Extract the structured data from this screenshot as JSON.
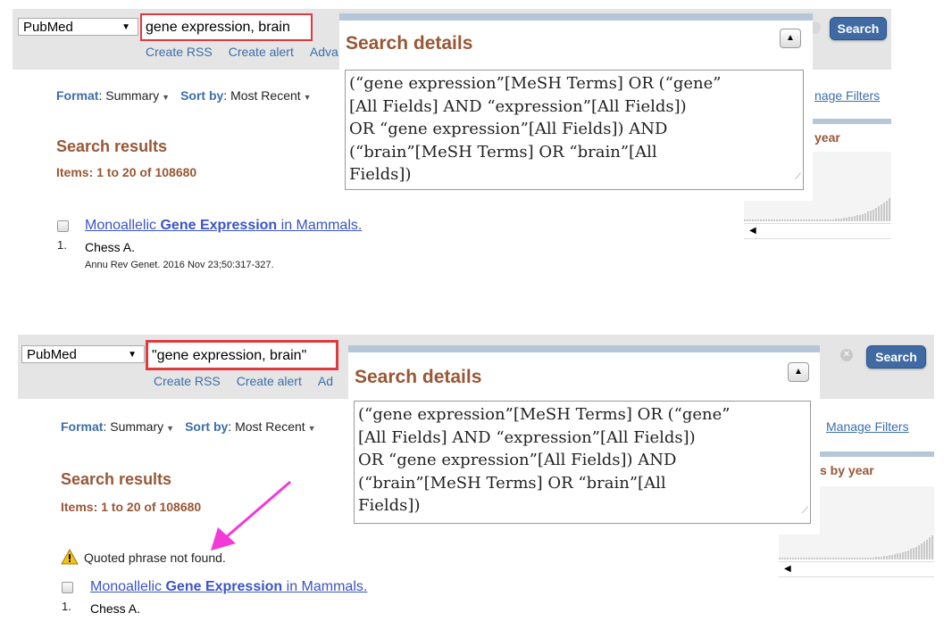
{
  "top": {
    "db_select": "PubMed",
    "search_value": "gene expression, brain",
    "create_rss": "Create RSS",
    "create_alert": "Create alert",
    "advanced": "Adva",
    "search_button": "Search"
  },
  "bottom": {
    "db_select": "PubMed",
    "search_value": "\"gene expression, brain\"",
    "create_rss": "Create RSS",
    "create_alert": "Create alert",
    "advanced": "Ad",
    "search_button": "Search",
    "clear_glyph": "✕"
  },
  "format": {
    "format_label": "Format",
    "format_value": "Summary",
    "sort_label": "Sort by",
    "sort_value": "Most Recent"
  },
  "results": {
    "heading": "Search results",
    "items": "Items: 1 to 20 of 108680"
  },
  "article": {
    "number": "1.",
    "title_pre": "Monoallelic ",
    "title_bold": "Gene Expression",
    "title_post": " in Mammals.",
    "author": "Chess A.",
    "journal": "Annu Rev Genet. 2016 Nov 23;50:317-327."
  },
  "search_details": {
    "title": "Search details",
    "query": "(\"gene expression\"[MeSH Terms] OR (\"gene\" [All Fields] AND \"expression\"[All Fields]) OR \"gene expression\"[All Fields]) AND (\"brain\"[MeSH Terms] OR \"brain\"[All Fields])",
    "lines": [
      "(“gene expression”[MeSH Terms] OR (“gene”",
      "[All Fields] AND “expression”[All Fields])",
      "OR “gene expression”[All Fields]) AND",
      "(“brain”[MeSH Terms] OR “brain”[All",
      "Fields])"
    ]
  },
  "right_panel": {
    "top_filters": "nage Filters",
    "top_year": "year",
    "bottom_filters": "Manage Filters",
    "bottom_year": "s by year",
    "scroll_left": "◀"
  },
  "warning": {
    "text": "Quoted phrase not found."
  },
  "colors": {
    "accent_blue": "#3c6ea9",
    "heading_brown": "#985735",
    "highlight_red": "#e0393e",
    "arrow_magenta": "#f23ad9"
  }
}
